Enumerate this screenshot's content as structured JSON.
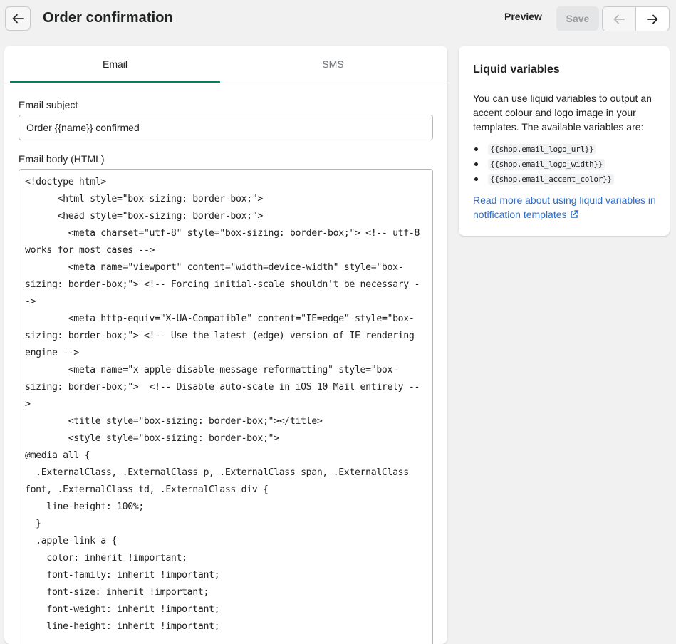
{
  "header": {
    "title": "Order confirmation",
    "preview_label": "Preview",
    "save_label": "Save"
  },
  "tabs": [
    {
      "label": "Email",
      "active": true
    },
    {
      "label": "SMS",
      "active": false
    }
  ],
  "form": {
    "subject_label": "Email subject",
    "subject_value": "Order {{name}} confirmed",
    "body_label": "Email body (HTML)",
    "body_lines": [
      "<!doctype html>",
      "      <html style=\"box-sizing: border-box;\">",
      "      <head style=\"box-sizing: border-box;\">",
      "        <meta charset=\"utf-8\" style=\"box-sizing: border-box;\"> <!-- utf-8",
      "works for most cases -->",
      "        <meta name=\"viewport\" content=\"width=device-width\" style=\"box-",
      "sizing: border-box;\"> <!-- Forcing initial-scale shouldn't be necessary -",
      "->",
      "        <meta http-equiv=\"X-UA-Compatible\" content=\"IE=edge\" style=\"box-",
      "sizing: border-box;\"> <!-- Use the latest (edge) version of IE rendering",
      "engine -->",
      "        <meta name=\"x-apple-disable-message-reformatting\" style=\"box-",
      "sizing: border-box;\">  <!-- Disable auto-scale in iOS 10 Mail entirely --",
      ">",
      "        <title style=\"box-sizing: border-box;\"></title>",
      "        <style style=\"box-sizing: border-box;\">",
      "@media all {",
      "  .ExternalClass, .ExternalClass p, .ExternalClass span, .ExternalClass",
      "font, .ExternalClass td, .ExternalClass div {",
      "    line-height: 100%;",
      "  }",
      "  .apple-link a {",
      "    color: inherit !important;",
      "    font-family: inherit !important;",
      "    font-size: inherit !important;",
      "    font-weight: inherit !important;",
      "    line-height: inherit !important;"
    ]
  },
  "sidebar": {
    "title": "Liquid variables",
    "description": "You can use liquid variables to output an accent colour and logo image in your templates. The available variables are:",
    "variables": [
      "{{shop.email_logo_url}}",
      "{{shop.email_logo_width}}",
      "{{shop.email_accent_color}}"
    ],
    "link_text": "Read more about using liquid variables in notification templates"
  },
  "colors": {
    "accent": "#008060",
    "link": "#2c6ecb",
    "background": "#f1f1f1"
  },
  "icons": {
    "back": "arrow-left-icon",
    "prev": "arrow-left-icon",
    "next": "arrow-right-icon",
    "external": "external-link-icon"
  }
}
